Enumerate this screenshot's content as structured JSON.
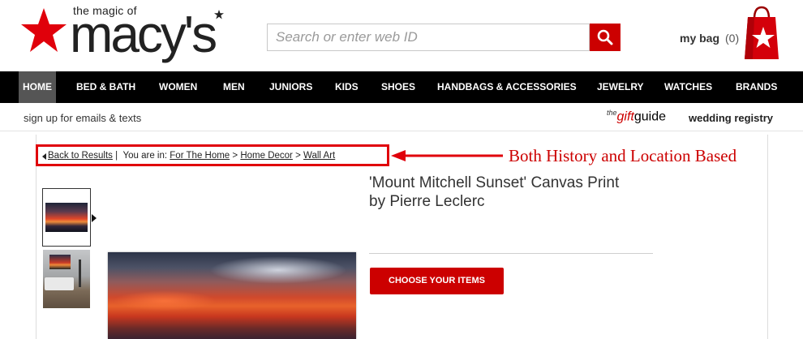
{
  "header": {
    "tagline": "the magic of",
    "wordmark": "macy's",
    "logo_icon": "red-star-logo",
    "search": {
      "placeholder": "Search or enter web ID",
      "button_icon": "search-icon"
    },
    "bag": {
      "label": "my bag",
      "count": "(0)",
      "icon": "shopping-bag-star-icon"
    }
  },
  "nav": {
    "items": [
      {
        "label": "HOME",
        "active": true
      },
      {
        "label": "BED & BATH"
      },
      {
        "label": "WOMEN"
      },
      {
        "label": "MEN"
      },
      {
        "label": "JUNIORS"
      },
      {
        "label": "KIDS"
      },
      {
        "label": "SHOES"
      },
      {
        "label": "HANDBAGS & ACCESSORIES"
      },
      {
        "label": "JEWELRY"
      },
      {
        "label": "WATCHES"
      },
      {
        "label": "BRANDS"
      }
    ]
  },
  "subheader": {
    "signup": "sign up for emails & texts",
    "giftguide": {
      "the": "the",
      "gift": "gift",
      "guide": "guide"
    },
    "registry": "wedding registry"
  },
  "breadcrumb": {
    "back": "Back to Results",
    "separator": "|",
    "prefix": "You are in:",
    "path": [
      "For The Home",
      "Home Decor",
      "Wall Art"
    ],
    "arrow": ">"
  },
  "annotation": "Both History and Location Based",
  "product": {
    "title_line1": "'Mount Mitchell Sunset' Canvas Print",
    "title_line2": "by Pierre Leclerc",
    "cta": "CHOOSE YOUR ITEMS"
  },
  "colors": {
    "brand_red": "#cc0000",
    "nav_bg": "#000000",
    "annotation_red": "#e0000b"
  }
}
